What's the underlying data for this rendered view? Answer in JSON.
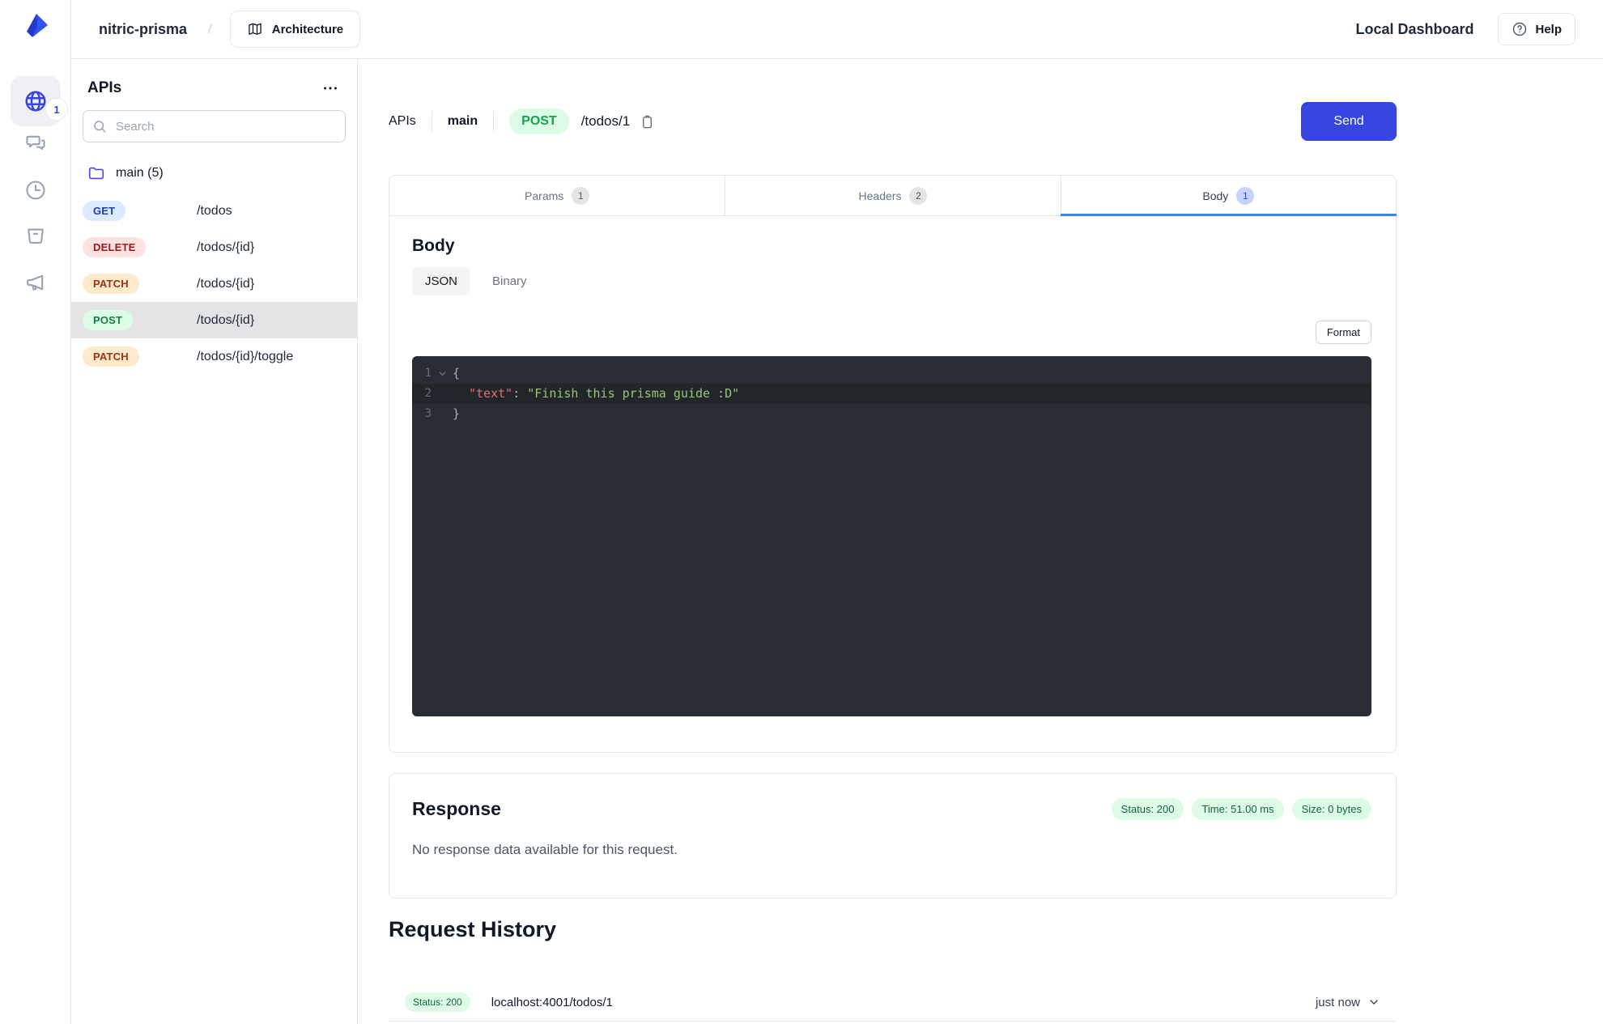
{
  "header": {
    "project": "nitric-prisma",
    "divider": "/",
    "architecture_label": "Architecture",
    "dashboard_label": "Local Dashboard",
    "help_label": "Help"
  },
  "rail": {
    "apis_badge": "1"
  },
  "sidebar": {
    "title": "APIs",
    "search_placeholder": "Search",
    "folder_label": "main (5)",
    "endpoints": [
      {
        "method": "GET",
        "path": "/todos"
      },
      {
        "method": "DELETE",
        "path": "/todos/{id}"
      },
      {
        "method": "PATCH",
        "path": "/todos/{id}"
      },
      {
        "method": "POST",
        "path": "/todos/{id}"
      },
      {
        "method": "PATCH",
        "path": "/todos/{id}/toggle"
      }
    ]
  },
  "request": {
    "breadcrumb_root": "APIs",
    "breadcrumb_api": "main",
    "method": "POST",
    "path": "/todos/1",
    "send_label": "Send"
  },
  "tabs": [
    {
      "label": "Params",
      "count": "1"
    },
    {
      "label": "Headers",
      "count": "2"
    },
    {
      "label": "Body",
      "count": "1"
    }
  ],
  "body_panel": {
    "title": "Body",
    "mode_json": "JSON",
    "mode_binary": "Binary",
    "format_label": "Format",
    "code": {
      "line1_no": "1",
      "line1": "{",
      "line2_no": "2",
      "line2_key": "\"text\"",
      "line2_sep": ": ",
      "line2_value": "\"Finish this prisma guide :D\"",
      "line3_no": "3",
      "line3": "}"
    }
  },
  "response": {
    "title": "Response",
    "status_badge": "Status: 200",
    "time_badge": "Time: 51.00 ms",
    "size_badge": "Size: 0 bytes",
    "empty_message": "No response data available for this request."
  },
  "history": {
    "title": "Request History",
    "rows": [
      {
        "status": "Status: 200",
        "url": "localhost:4001/todos/1",
        "time": "just now"
      }
    ]
  },
  "colors": {
    "accent": "#3746e0",
    "tab_active_underline": "#3b82f6",
    "success_bg": "#dcfce7",
    "success_text": "#166534",
    "get_bg": "#dbeafe",
    "get_text": "#1e40af",
    "delete_bg": "#fee2e2",
    "delete_text": "#991b1b",
    "patch_bg": "#fdeacc",
    "patch_text": "#9a3412",
    "post_bg": "#dcfce7",
    "post_text": "#15803d",
    "editor_bg": "#282c34",
    "editor_key": "#e06c75",
    "editor_string": "#98c379"
  }
}
